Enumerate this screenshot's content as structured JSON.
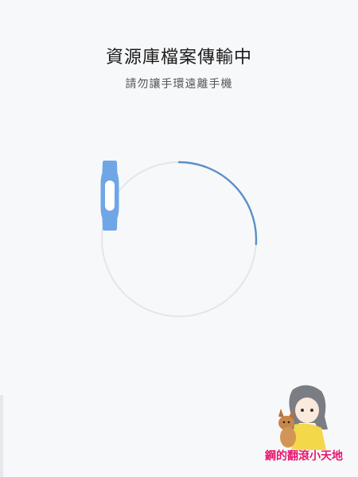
{
  "header": {
    "title": "資源庫檔案傳輸中",
    "subtitle": "請勿讓手環遠離手機"
  },
  "transfer": {
    "progress_fraction": 0.26
  },
  "colors": {
    "background": "#f7f8fa",
    "ring_track": "#e3e6ea",
    "ring_progress": "#5b8fc9",
    "band": "#6fa6e6",
    "band_screen": "#ffffff"
  },
  "watermark": {
    "text": "鋼的翻滾小天地"
  }
}
